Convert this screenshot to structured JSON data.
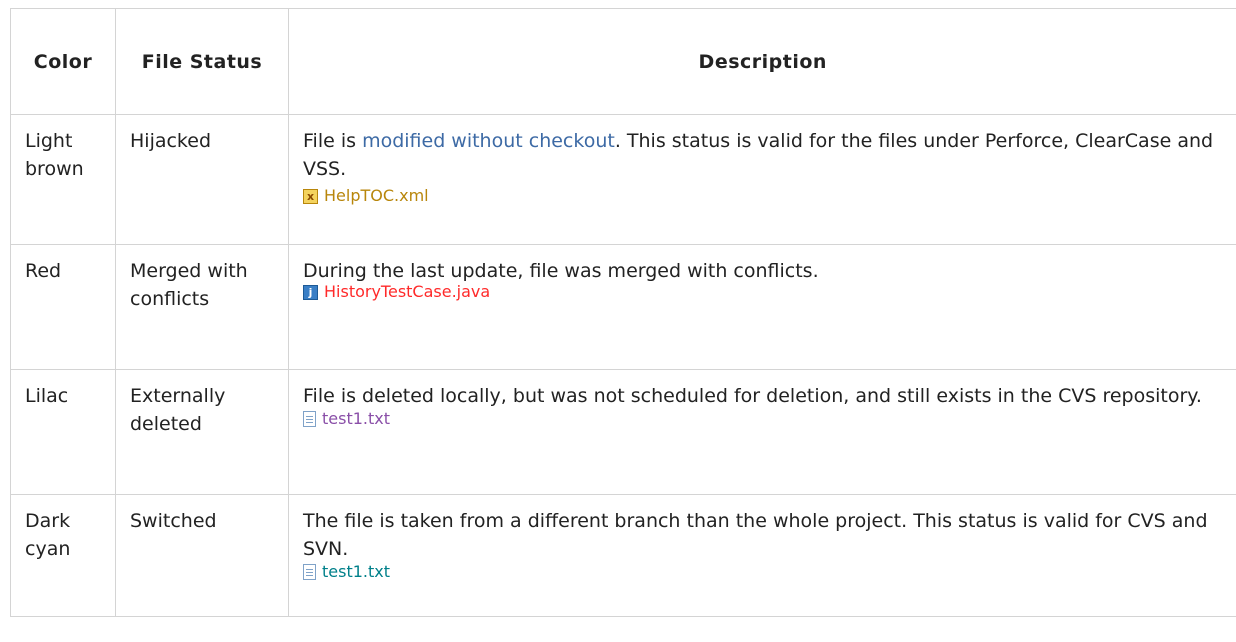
{
  "headers": {
    "color": "Color",
    "file_status": "File Status",
    "description": "Description"
  },
  "rows": [
    {
      "color": "Light brown",
      "status": "Hijacked",
      "desc_before": "File is ",
      "desc_link": "modified without checkout",
      "desc_after": ". This status is valid for the files under Perforce, ClearCase and VSS.",
      "sample_file": "HelpTOC.xml",
      "sample_color": "#b8860b",
      "sample_icon": "xml-file-icon"
    },
    {
      "color": "Red",
      "status": "Merged with conflicts",
      "desc_before": "During the last update, file was merged with conflicts.",
      "desc_link": "",
      "desc_after": "",
      "sample_file": "HistoryTestCase.java",
      "sample_color": "#ff2a2a",
      "sample_icon": "java-file-icon"
    },
    {
      "color": "Lilac",
      "status": "Externally deleted",
      "desc_before": "File is deleted locally, but was not scheduled for deletion, and still exists in the CVS repository.",
      "desc_link": "",
      "desc_after": "",
      "sample_file": "test1.txt",
      "sample_color": "#8a4fa8",
      "sample_icon": "text-file-icon"
    },
    {
      "color": "Dark cyan",
      "status": "Switched",
      "desc_before": "The file is taken from a different branch than the whole project. This status is valid for CVS and SVN.",
      "desc_link": "",
      "desc_after": "",
      "sample_file": "test1.txt",
      "sample_color": "#00808a",
      "sample_icon": "text-file-icon"
    }
  ]
}
